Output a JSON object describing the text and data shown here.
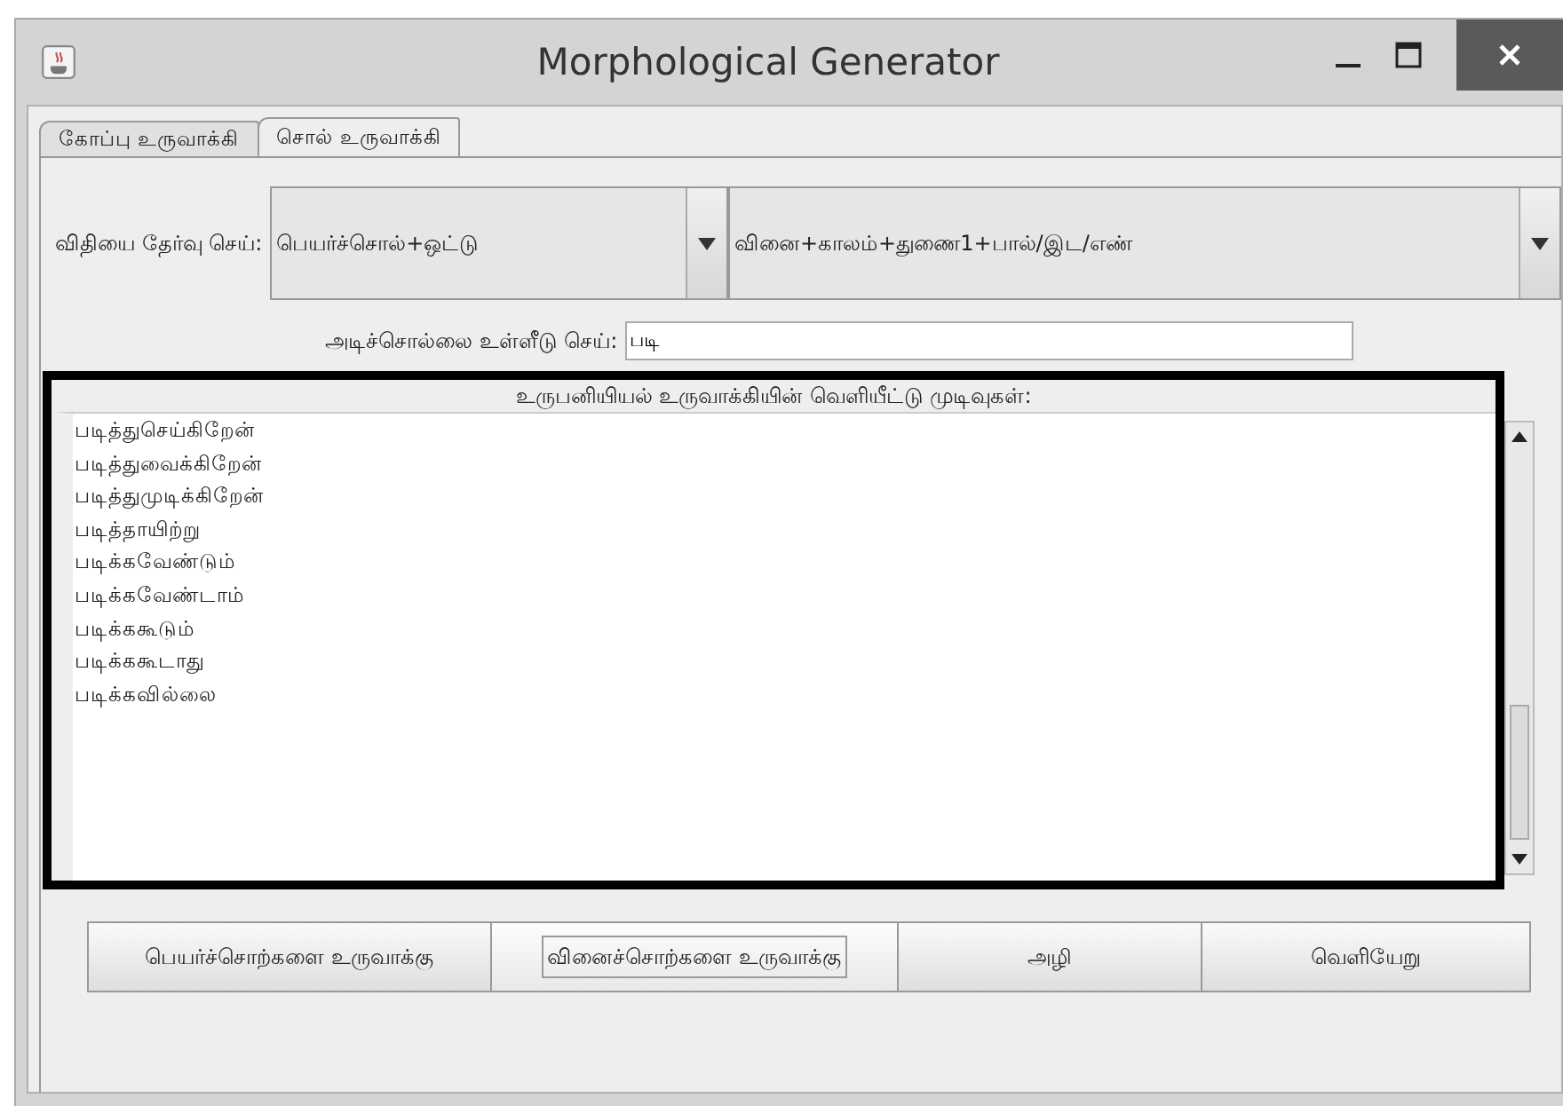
{
  "window": {
    "title": "Morphological Generator"
  },
  "tabs": [
    {
      "label": "கோப்பு உருவாக்கி",
      "selected": false
    },
    {
      "label": "சொல் உருவாக்கி",
      "selected": true
    }
  ],
  "rule": {
    "label": "விதியை தேர்வு செய்:",
    "combo_1": "பெயர்ச்சொல்+ஒட்டு",
    "combo_2": "வினை+காலம்+துணை1+பால்/இட/எண்"
  },
  "root_input": {
    "label": "அடிச்சொல்லை உள்ளீடு செய்:",
    "value": "படி"
  },
  "output": {
    "heading": "உருபனியியல் உருவாக்கியின் வெளியீட்டு முடிவுகள்:",
    "lines": [
      "படித்துசெய்கிறேன்",
      "படித்துவைக்கிறேன்",
      "படித்துமுடிக்கிறேன்",
      "படித்தாயிற்று",
      "படிக்கவேண்டும்",
      "படிக்கவேண்டாம்",
      "படிக்ககூடும்",
      "படிக்ககூடாது",
      "படிக்கவில்லை"
    ]
  },
  "buttons": [
    {
      "label": "பெயர்ச்சொற்களை உருவாக்கு",
      "focused": false
    },
    {
      "label": "வினைச்சொற்களை உருவாக்கு",
      "focused": true
    },
    {
      "label": "அழி",
      "focused": false
    },
    {
      "label": "வெளியேறு",
      "focused": false
    }
  ]
}
